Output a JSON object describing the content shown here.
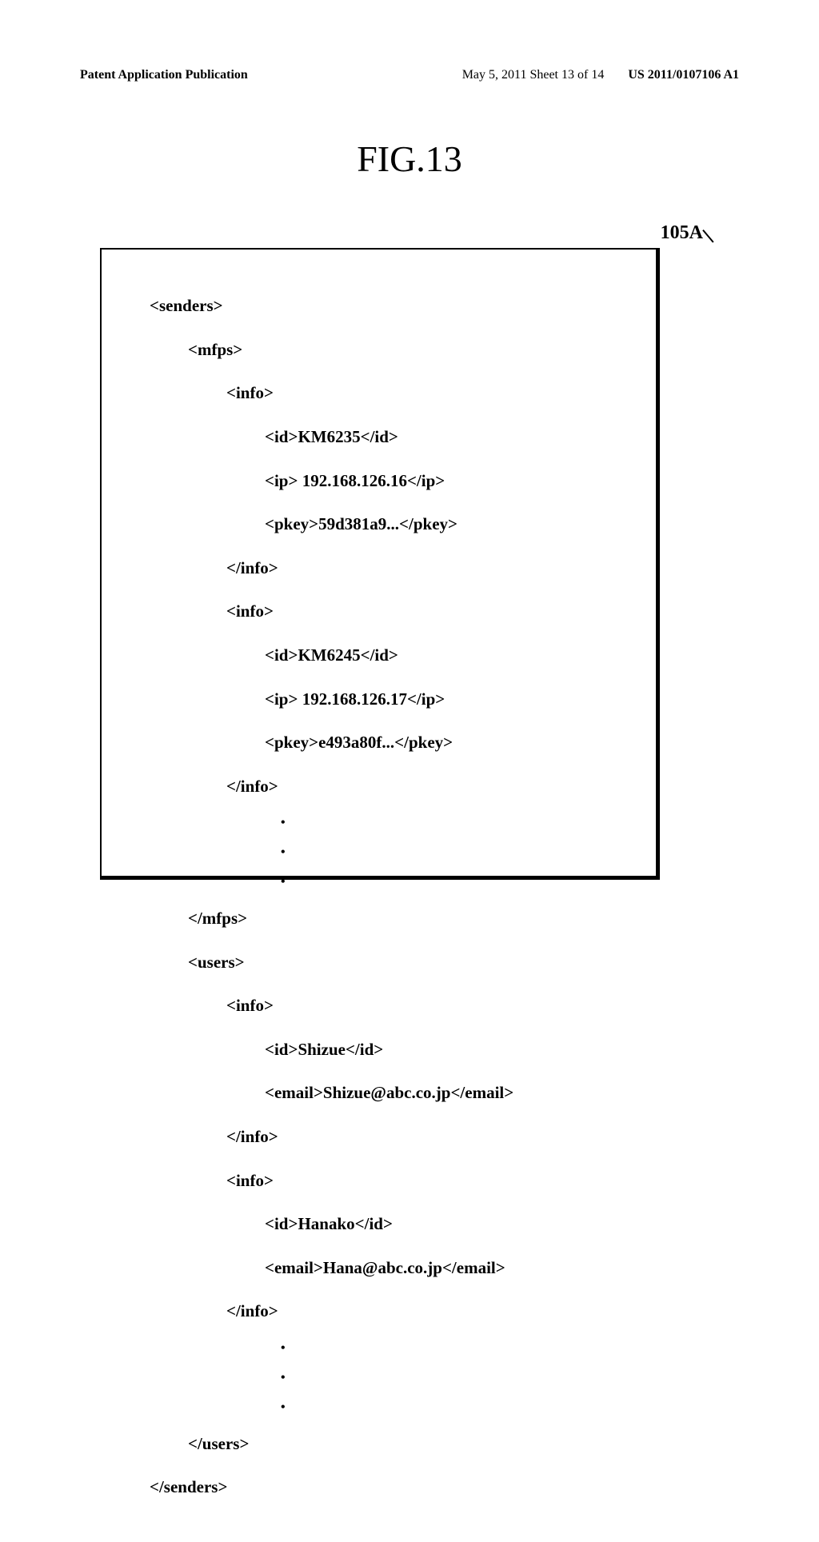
{
  "header": {
    "left": "Patent Application Publication",
    "center": "May 5, 2011  Sheet 13 of 14",
    "right": "US 2011/0107106 A1"
  },
  "figure_title": "FIG.13",
  "reference_label": "105A",
  "xml": {
    "senders_open": "<senders>",
    "mfps_open": "<mfps>",
    "info_open": "<info>",
    "mfp1_id": "<id>KM6235</id>",
    "mfp1_ip": "<ip> 192.168.126.16</ip>",
    "mfp1_pkey": "<pkey>59d381a9...</pkey>",
    "info_close": "</info>",
    "mfp2_id": "<id>KM6245</id>",
    "mfp2_ip": "<ip> 192.168.126.17</ip>",
    "mfp2_pkey": "<pkey>e493a80f...</pkey>",
    "mfps_close": "</mfps>",
    "users_open": "<users>",
    "user1_id": "<id>Shizue</id>",
    "user1_email": "<email>Shizue@abc.co.jp</email>",
    "user2_id": "<id>Hanako</id>",
    "user2_email": "<email>Hana@abc.co.jp</email>",
    "users_close": "</users>",
    "senders_close": "</senders>",
    "dot": "•"
  }
}
